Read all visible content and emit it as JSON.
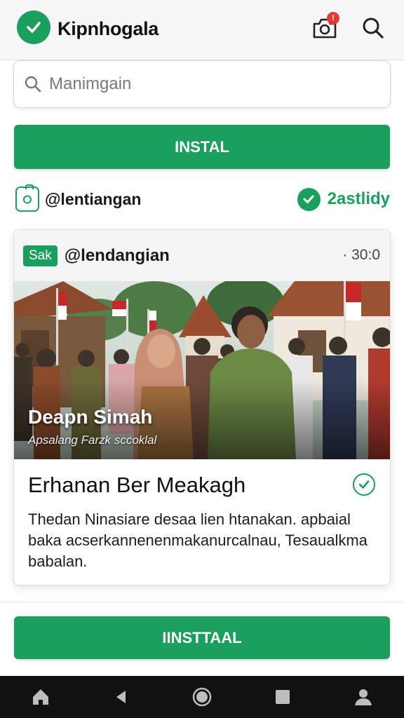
{
  "header": {
    "app_title": "Kipnhogala",
    "logo_icon": "check-circle-icon",
    "notification_count": "!",
    "camera_icon": "camera-icon",
    "search_icon": "search-icon"
  },
  "search": {
    "placeholder": "Manimgain"
  },
  "install_top": {
    "label": "INSTAL"
  },
  "account": {
    "handle": "@lentiangan",
    "status": "2astlidy",
    "icon": "instagram-icon"
  },
  "card": {
    "tag": "Sak",
    "handle": "@lendangian",
    "time": "· 30:0",
    "media_title": "Deapn Simah",
    "media_subtitle": "Apsalang Farzk sccoklal",
    "title": "Erhanan Ber Meakagh",
    "body": "Thedan Ninasiare desaa lien htanakan. apbaial baka acserkannenenmakanurcalnau, Tesaualkma babalan."
  },
  "install_bottom": {
    "label": "IINSTTAAL"
  },
  "nav": [
    "home-icon",
    "back-icon",
    "home-circle-icon",
    "recents-icon",
    "profile-icon"
  ],
  "colors": {
    "accent": "#1a9f5e",
    "badge": "#e53935",
    "navbar": "#111111"
  }
}
